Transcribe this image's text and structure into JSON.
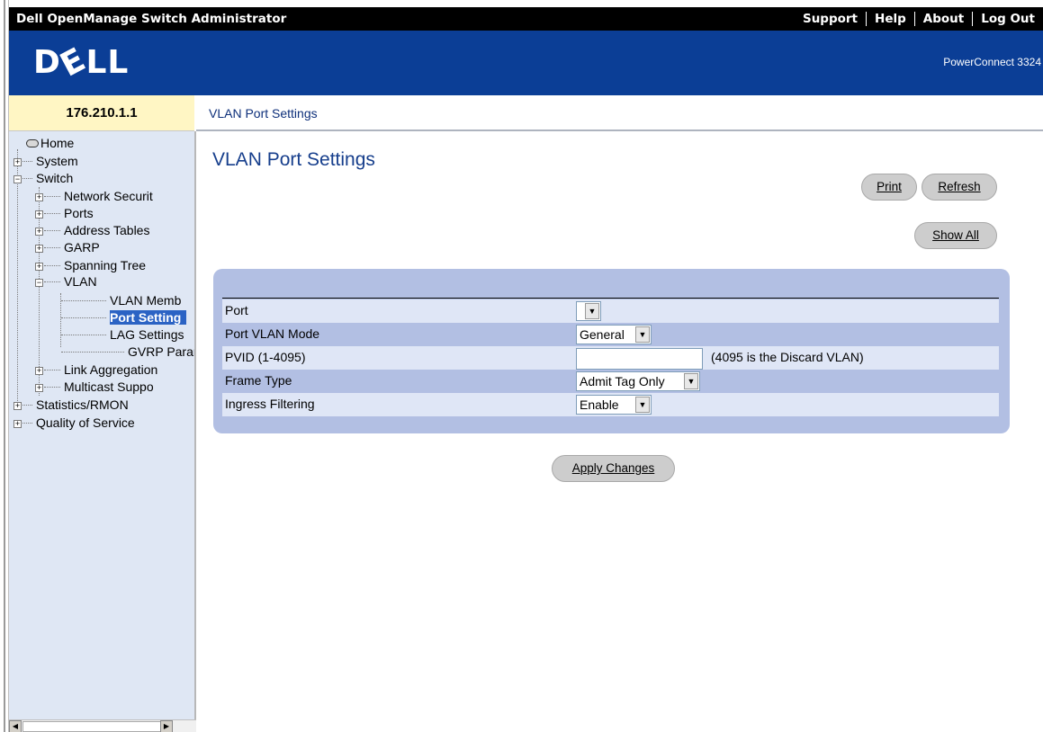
{
  "header": {
    "app_title": "Dell OpenManage Switch Administrator",
    "links": [
      "Support",
      "Help",
      "About",
      "Log Out"
    ],
    "brand": "DELL",
    "product": "PowerConnect 3324"
  },
  "sidebar": {
    "ip": "176.210.1.1",
    "tree": {
      "home": "Home",
      "system": "System",
      "switch": "Switch",
      "network_security": "Network Securit",
      "ports": "Ports",
      "address_tables": "Address Tables",
      "garp": "GARP",
      "spanning_tree": "Spanning Tree",
      "vlan": "VLAN",
      "vlan_membership": "VLAN Memb",
      "port_settings": "Port Setting",
      "lag_settings": "LAG Settings",
      "gvrp_parameters": "GVRP Paran",
      "link_aggregation": "Link Aggregation",
      "multicast_support": "Multicast Suppo",
      "statistics_rmon": "Statistics/RMON",
      "quality_of_service": "Quality of Service"
    }
  },
  "main": {
    "breadcrumb": "VLAN Port Settings",
    "title": "VLAN Port Settings",
    "buttons": {
      "print": "Print",
      "refresh": "Refresh",
      "show_all": "Show All",
      "apply": "Apply Changes"
    },
    "form": {
      "port_label": "Port",
      "port_value": "",
      "mode_label": "Port VLAN Mode",
      "mode_value": "General",
      "pvid_label": "PVID (1-4095)",
      "pvid_value": "",
      "pvid_hint": "(4095 is the Discard VLAN)",
      "frame_label": "Frame Type",
      "frame_value": "Admit Tag Only",
      "ingress_label": "Ingress Filtering",
      "ingress_value": "Enable"
    }
  },
  "colors": {
    "banner": "#0b3e96",
    "nav_bg": "#dfe7f4",
    "selected": "#2b63c4",
    "panel": "#b2bfe3"
  },
  "icons": {
    "expand": "plus-box-icon",
    "collapse": "minus-box-icon",
    "home": "drive-icon",
    "dropdown": "chevron-down-icon"
  }
}
